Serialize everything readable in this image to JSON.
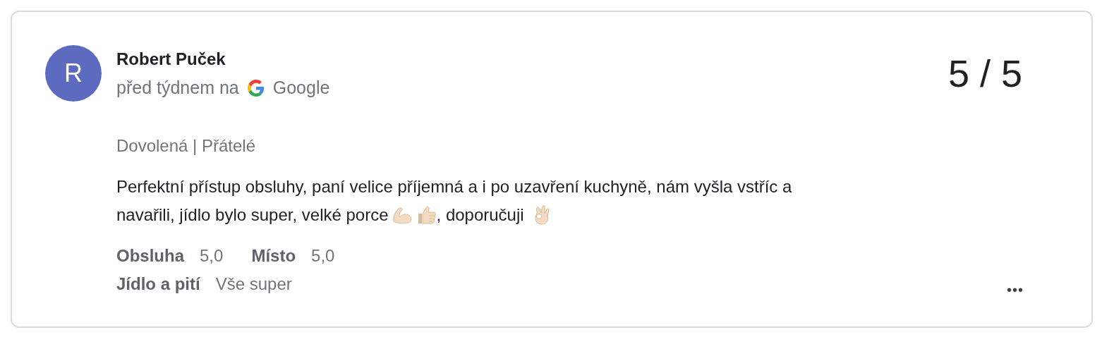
{
  "review": {
    "author": {
      "name": "Robert Puček",
      "initial": "R",
      "color": "#5c6bc0"
    },
    "posted": "před týdnem na",
    "source": "Google",
    "score": "5 / 5",
    "tags": "Dovolená | Přátelé",
    "text": [
      [
        {
          "kind": "text",
          "text": "Perfektní přístup obsluhy, paní velice příjemná a i po uzavření kuchyně, nám vyšla vstříc a"
        }
      ],
      [
        {
          "kind": "text",
          "text": "navařili, jídlo bylo super, velké porce"
        },
        {
          "kind": "muscle"
        },
        {
          "kind": "thumb"
        },
        {
          "kind": "text",
          "text": ", doporučuji"
        },
        {
          "kind": "ok"
        }
      ]
    ],
    "ratings": [
      [
        {
          "label": "Obsluha",
          "value": "5,0"
        },
        {
          "label": "Místo",
          "value": "5,0"
        }
      ],
      [
        {
          "label": "Jídlo a pití",
          "value": "Vše super"
        }
      ]
    ],
    "more": "•••"
  }
}
